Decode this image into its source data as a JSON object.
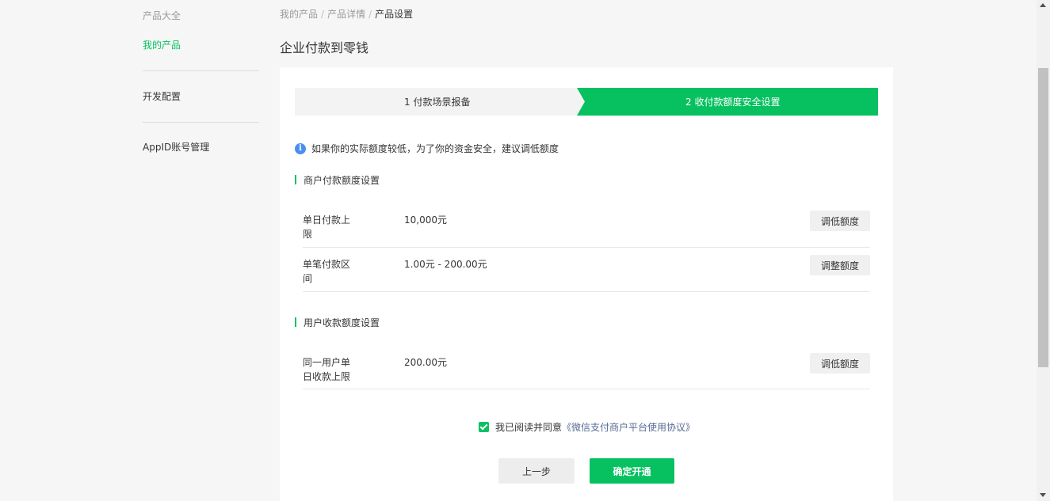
{
  "sidebar": {
    "group_title": "产品大全",
    "items": [
      {
        "label": "我的产品",
        "active": true
      },
      {
        "label": "开发配置"
      },
      {
        "label": "AppID账号管理"
      }
    ]
  },
  "breadcrumb": [
    "我的产品",
    "产品详情",
    "产品设置"
  ],
  "breadcrumb_sep": "/",
  "page_title": "企业付款到零钱",
  "steps": [
    {
      "label": "1 付款场景报备",
      "active": false
    },
    {
      "label": "2 收付款额度安全设置",
      "active": true
    }
  ],
  "notice": {
    "icon": "info-icon",
    "text": "如果你的实际额度较低，为了你的资金安全，建议调低额度"
  },
  "sections": [
    {
      "title": "商户付款额度设置",
      "rows": [
        {
          "label": "单日付款上限",
          "value": "10,000元",
          "button": "调低额度"
        },
        {
          "label": "单笔付款区间",
          "value": "1.00元 - 200.00元",
          "button": "调整额度"
        }
      ]
    },
    {
      "title": "用户收款额度设置",
      "rows": [
        {
          "label": "同一用户单日收款上限",
          "value": "200.00元",
          "button": "调低额度"
        }
      ]
    }
  ],
  "agreement": {
    "checked": true,
    "text": "我已阅读并同意",
    "link": "《微信支付商户平台使用协议》"
  },
  "buttons": {
    "prev": "上一步",
    "confirm": "确定开通"
  },
  "colors": {
    "accent": "#07c160",
    "link": "#576b95",
    "info": "#4a8ff0"
  }
}
